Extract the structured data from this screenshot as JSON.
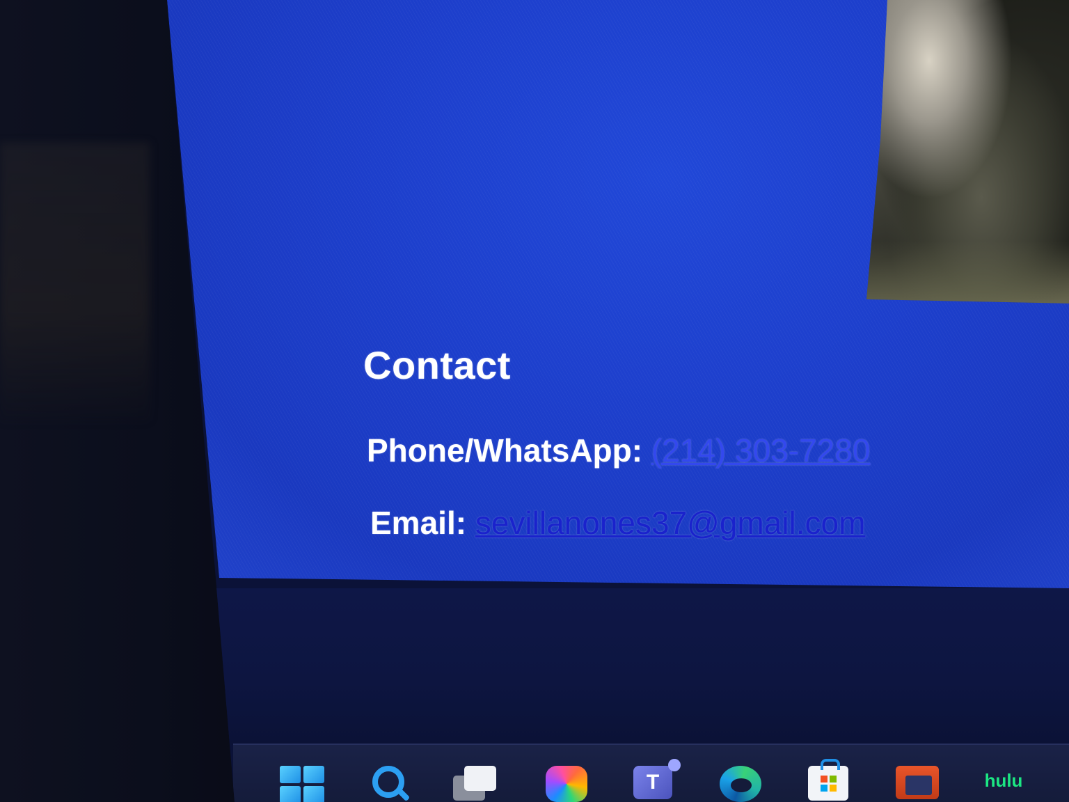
{
  "contact": {
    "title": "Contact",
    "phone_label": "Phone/WhatsApp:",
    "phone_value": "(214) 303-7280",
    "email_label": "Email:",
    "email_value": "sevillanones37@gmail.com"
  },
  "taskbar": {
    "apps": [
      {
        "name": "start",
        "icon": "windows-logo-icon"
      },
      {
        "name": "search",
        "icon": "search-icon"
      },
      {
        "name": "task-view",
        "icon": "task-view-icon"
      },
      {
        "name": "copilot",
        "icon": "copilot-icon"
      },
      {
        "name": "teams",
        "icon": "teams-icon",
        "glyph": "T"
      },
      {
        "name": "edge",
        "icon": "edge-icon"
      },
      {
        "name": "store",
        "icon": "store-icon"
      },
      {
        "name": "file-explorer",
        "icon": "file-explorer-icon"
      },
      {
        "name": "hulu",
        "icon": "hulu-icon",
        "label": "hulu"
      }
    ]
  },
  "colors": {
    "page_background": "#1d3fcc",
    "link": "#2030e0",
    "text": "#ffffff",
    "taskbar": "#141b3a"
  }
}
